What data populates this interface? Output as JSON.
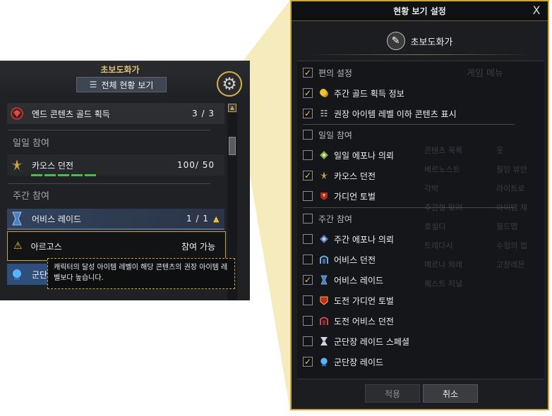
{
  "left_panel": {
    "character_name": "초보도화가",
    "view_all_button": "전체 현황 보기",
    "rows": {
      "end_content": {
        "label": "엔드 콘텐츠 골드 획득",
        "value": "3 / 3"
      },
      "daily_section": "일일 참여",
      "chaos_dungeon": {
        "label": "카오스 던전",
        "value": "100/ 50"
      },
      "weekly_section": "주간 참여",
      "abyss_raid": {
        "label": "어비스 레이드",
        "value": "1 / 1"
      },
      "argos": {
        "label": "아르고스",
        "value": "참여 가능"
      },
      "guild_partial": "군단"
    },
    "tooltip": "캐릭터의 달성 아이템 레벨이 해당 콘텐츠의 권장 아이템 레벨보다 높습니다.",
    "colors": {
      "accent": "#c9a43a",
      "progress": "#3fc14a",
      "warning": "#f2c230"
    }
  },
  "settings_dialog": {
    "title": "현황 보기 설정",
    "close_label": "X",
    "character_name": "초보도화가",
    "ghost_header": "게임 메뉴",
    "ghost_items_left": [
      "콘텐츠 목록",
      "베르노스트",
      "각박",
      "주간형 맞러",
      "호설디",
      "트레다시",
      "메르나 의례",
      "퀘스트 저널"
    ],
    "ghost_items_right": [
      "옷",
      "필잉 뷰안",
      "라이트로",
      "아이템 제",
      "월드맵",
      "수정의 법",
      "고장레몬"
    ],
    "items": [
      {
        "label": "편의 설정",
        "checked": true,
        "section": true,
        "icon": ""
      },
      {
        "label": "주간 골드 획득 정보",
        "checked": true,
        "section": false,
        "icon": "gold-coins-icon"
      },
      {
        "label": "권장 아이템 레벨 이하 콘텐츠 표시",
        "checked": true,
        "section": false,
        "icon": "list-icon"
      },
      {
        "label": "일일 참여",
        "checked": false,
        "section": true,
        "icon": ""
      },
      {
        "label": "일일 에포나 의뢰",
        "checked": false,
        "section": false,
        "icon": "epona-daily-icon"
      },
      {
        "label": "카오스 던전",
        "checked": true,
        "section": false,
        "icon": "chaos-dungeon-icon"
      },
      {
        "label": "가디언 토벌",
        "checked": false,
        "section": false,
        "icon": "guardian-raid-icon"
      },
      {
        "label": "주간 참여",
        "checked": false,
        "section": true,
        "icon": ""
      },
      {
        "label": "주간 에포나 의뢰",
        "checked": false,
        "section": false,
        "icon": "epona-weekly-icon"
      },
      {
        "label": "어비스 던전",
        "checked": false,
        "section": false,
        "icon": "abyss-dungeon-icon"
      },
      {
        "label": "어비스 레이드",
        "checked": true,
        "section": false,
        "icon": "abyss-raid-icon"
      },
      {
        "label": "도전 가디언 토벌",
        "checked": false,
        "section": false,
        "icon": "challenge-guardian-icon"
      },
      {
        "label": "도전 어비스 던전",
        "checked": false,
        "section": false,
        "icon": "challenge-abyss-icon"
      },
      {
        "label": "군단장 레이드 스페셜",
        "checked": false,
        "section": false,
        "icon": "legion-special-icon"
      },
      {
        "label": "군단장 레이드",
        "checked": true,
        "section": false,
        "icon": "legion-raid-icon"
      }
    ],
    "apply_button": "적용",
    "cancel_button": "취소",
    "colors": {
      "border": "#c9a43a",
      "check": "#e8c35a"
    }
  }
}
